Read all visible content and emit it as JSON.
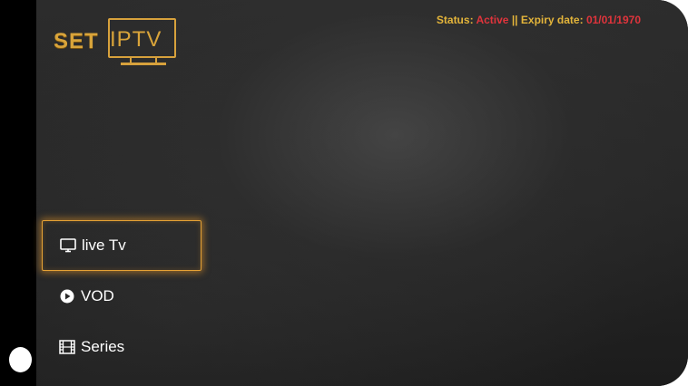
{
  "logo": {
    "text_left": "SET",
    "text_right": "IPTV",
    "color": "#d9a43a"
  },
  "status": {
    "status_label": "Status:",
    "status_value": "Active",
    "separator": "||",
    "expiry_label": "Expiry date:",
    "expiry_value": "01/01/1970",
    "label_color": "#e3b43a",
    "value_color": "#e0343c"
  },
  "menu": {
    "items": [
      {
        "label": "live Tv",
        "icon": "tv-icon",
        "active": true
      },
      {
        "label": "VOD",
        "icon": "play-circle-icon",
        "active": false
      },
      {
        "label": "Series",
        "icon": "film-icon",
        "active": false
      }
    ],
    "accent_color": "#e6a235"
  }
}
